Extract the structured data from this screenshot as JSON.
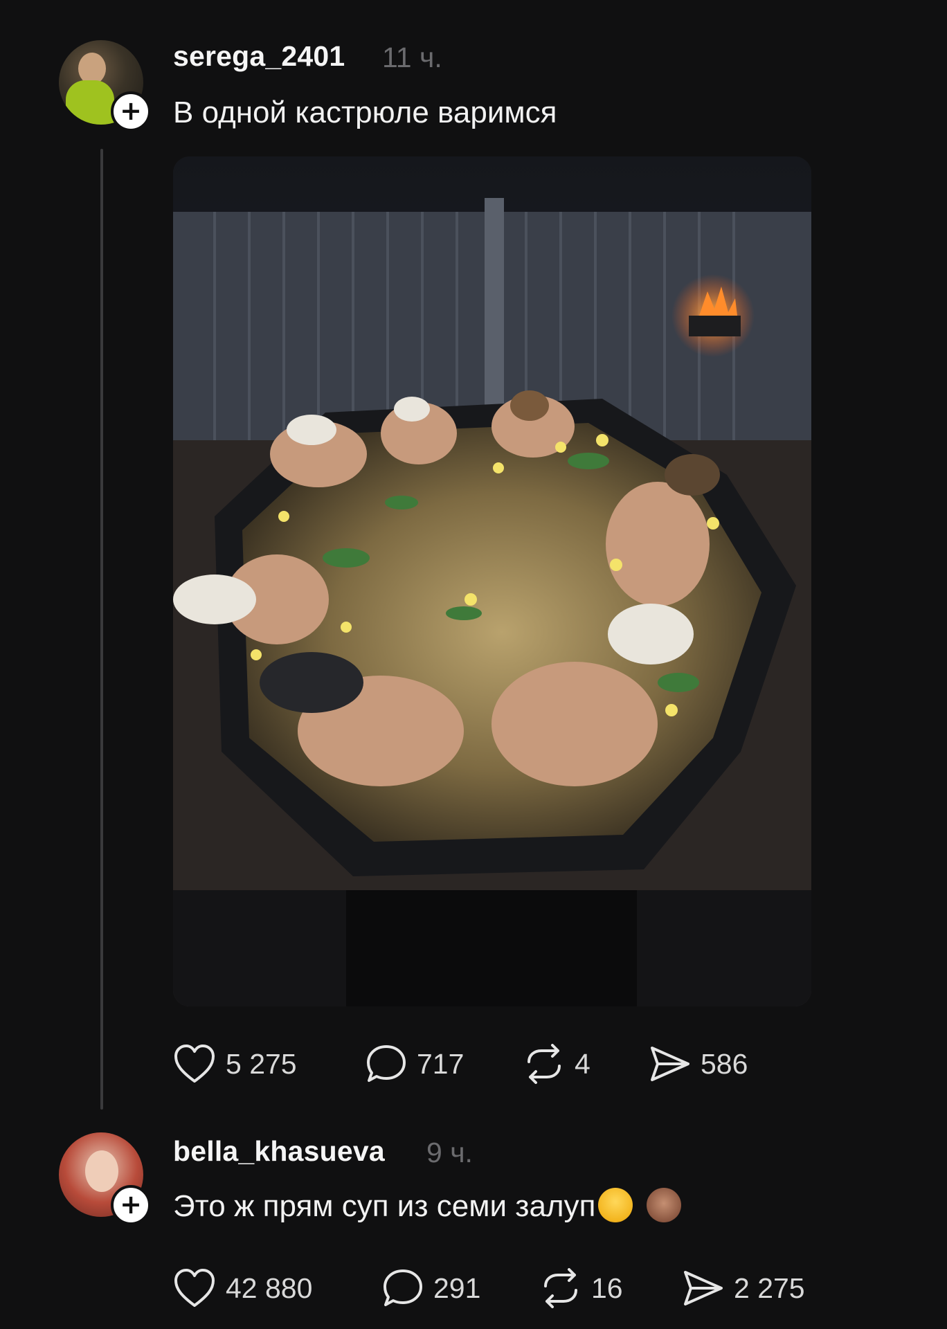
{
  "post": {
    "username": "serega_2401",
    "time": "11 ч.",
    "text": "В одной кастрюле варимся",
    "stats": {
      "likes": "5 275",
      "comments": "717",
      "reposts": "4",
      "shares": "586"
    }
  },
  "reply": {
    "username": "bella_khasueva",
    "time": "9 ч.",
    "text": "Это ж прям суп из семи залуп",
    "emojis": [
      "face-with-tears-of-joy-icon",
      "see-no-evil-monkey-icon"
    ],
    "stats": {
      "likes": "42 880",
      "comments": "291",
      "reposts": "16",
      "shares": "2 275"
    }
  },
  "icons": {
    "like": "heart-icon",
    "comment": "comment-bubble-icon",
    "repost": "repost-arrows-icon",
    "share": "send-arrow-icon",
    "follow": "plus-icon"
  },
  "follow_badge": "+",
  "colors": {
    "background": "#101011",
    "thread_line": "#3a3a3c",
    "muted_text": "#6b6b6e"
  }
}
